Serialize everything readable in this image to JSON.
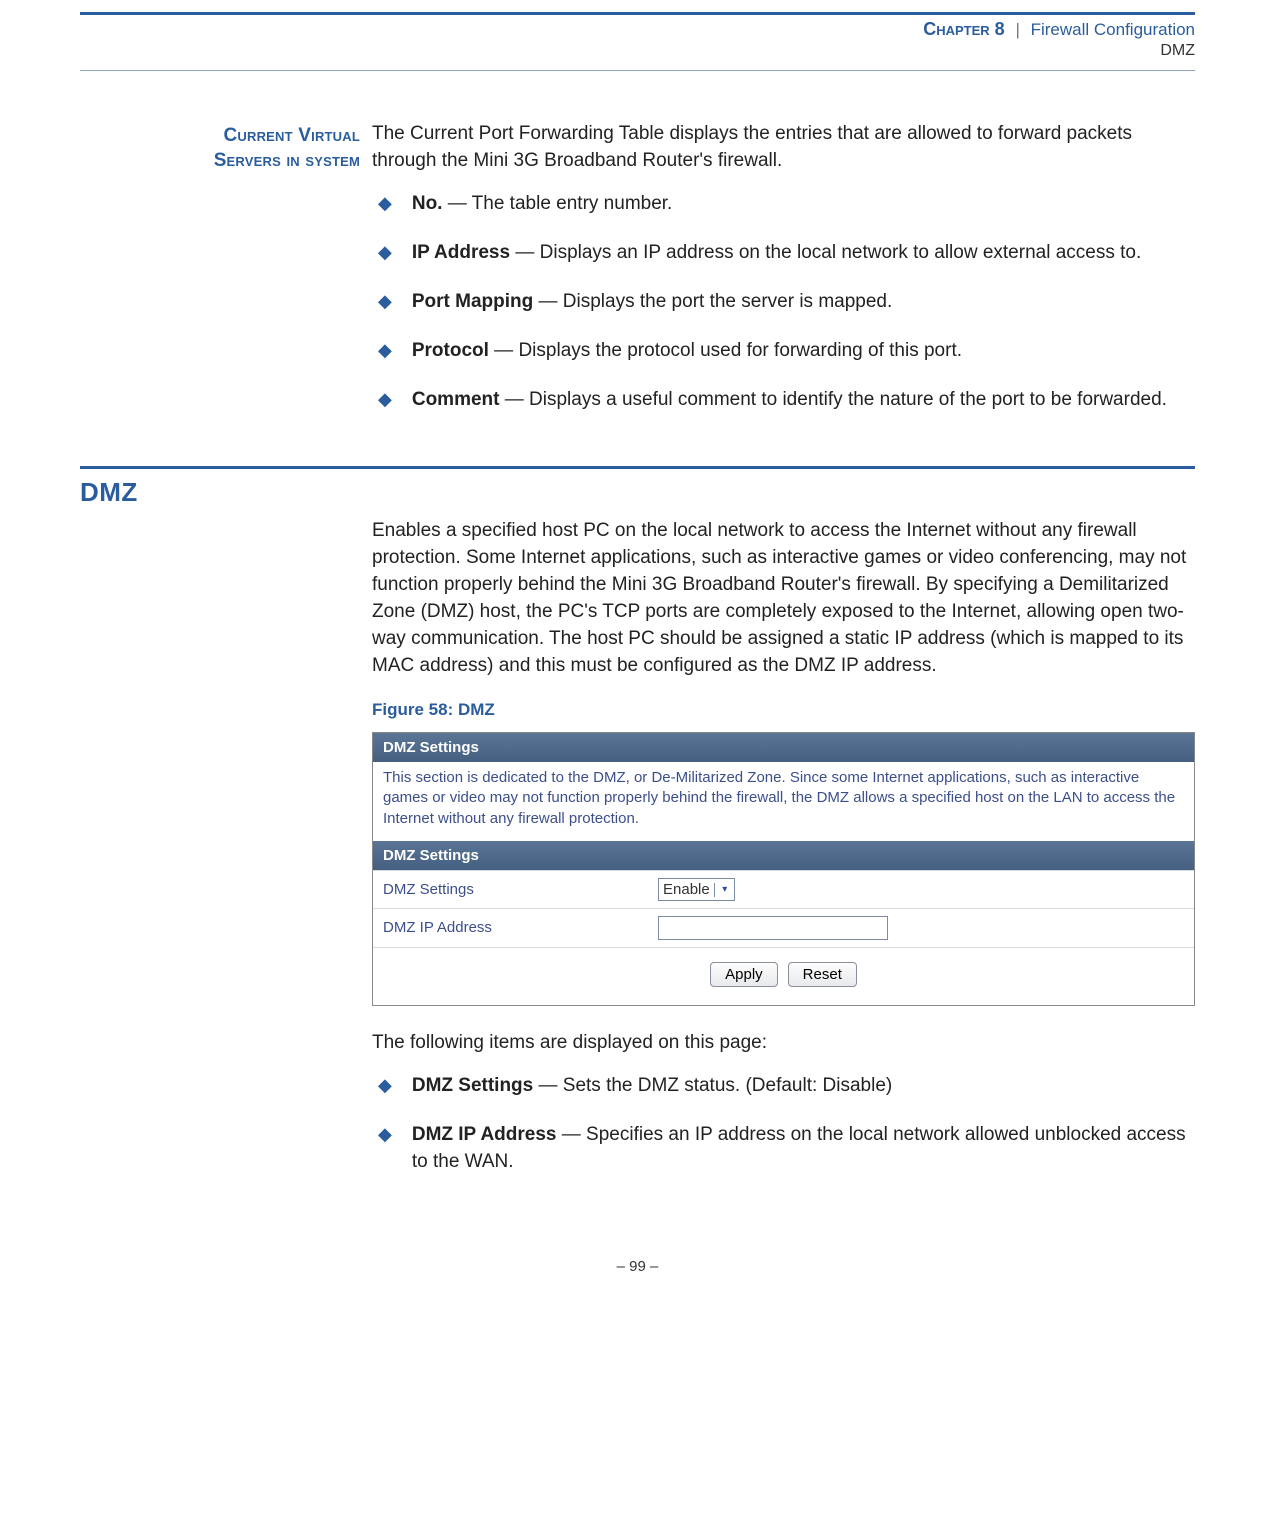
{
  "header": {
    "chapter_label": "Chapter 8",
    "separator": "|",
    "chapter_title": "Firewall Configuration",
    "subtitle": "DMZ"
  },
  "section1": {
    "side_heading_line1": "Current Virtual",
    "side_heading_line2": "Servers in system",
    "intro": "The Current Port Forwarding Table displays the entries that are allowed to forward packets through the Mini 3G Broadband Router's firewall.",
    "items": [
      {
        "term": "No.",
        "desc": " — The table entry number."
      },
      {
        "term": "IP Address",
        "desc": " — Displays an IP address on the local network to allow external access to."
      },
      {
        "term": "Port Mapping",
        "desc": " — Displays the port the server is mapped."
      },
      {
        "term": "Protocol",
        "desc": " — Displays the protocol used for forwarding of this port."
      },
      {
        "term": "Comment",
        "desc": " — Displays a useful comment to identify the nature of the port to be forwarded."
      }
    ]
  },
  "section2": {
    "heading": "DMZ",
    "intro": "Enables a specified host PC on the local network to access the Internet without any firewall protection. Some Internet applications, such as interactive games or video conferencing, may not function properly behind the Mini 3G Broadband Router's firewall. By specifying a Demilitarized Zone (DMZ) host, the PC's TCP ports are completely exposed to the Internet, allowing open two-way communication. The host PC should be assigned a static IP address (which is mapped to its MAC address) and this must be configured as the DMZ IP address.",
    "figure_label": "Figure 58:  DMZ",
    "ui": {
      "bar1": "DMZ Settings",
      "desc": "This section is dedicated to the DMZ, or De-Militarized Zone. Since some Internet applications, such as interactive games or video may not function properly behind the firewall, the DMZ allows a specified host on the LAN to access the Internet without any firewall protection.",
      "bar2": "DMZ Settings",
      "row1_label": "DMZ Settings",
      "row1_value": "Enable",
      "row2_label": "DMZ IP Address",
      "row2_value": "",
      "apply": "Apply",
      "reset": "Reset"
    },
    "after_figure": "The following items are displayed on this page:",
    "items": [
      {
        "term": "DMZ Settings",
        "desc": " — Sets the DMZ status. (Default: Disable)"
      },
      {
        "term": "DMZ IP Address",
        "desc": " — Specifies an IP address on the local network allowed unblocked access to the WAN."
      }
    ]
  },
  "footer": "–  99  –"
}
